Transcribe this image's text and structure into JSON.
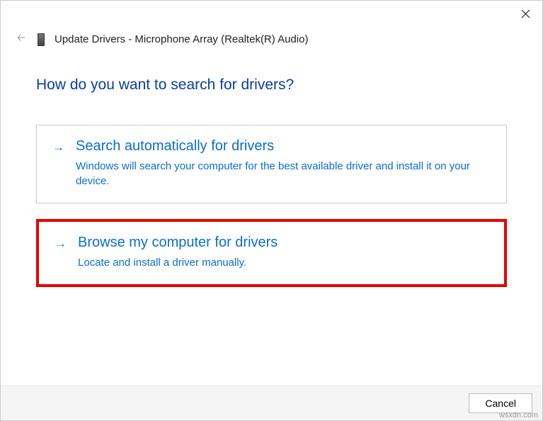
{
  "header": {
    "title": "Update Drivers - Microphone Array (Realtek(R) Audio)"
  },
  "question": "How do you want to search for drivers?",
  "options": [
    {
      "title": "Search automatically for drivers",
      "description": "Windows will search your computer for the best available driver and install it on your device."
    },
    {
      "title": "Browse my computer for drivers",
      "description": "Locate and install a driver manually."
    }
  ],
  "footer": {
    "cancel": "Cancel"
  },
  "watermark": "wsxdn.com"
}
